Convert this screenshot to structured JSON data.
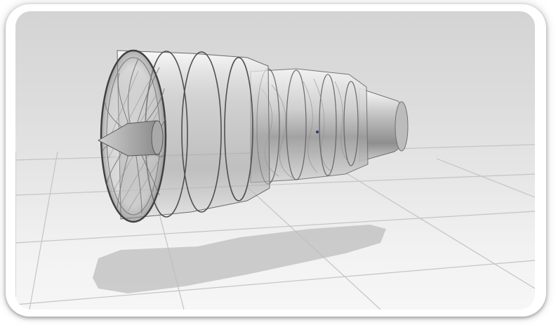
{
  "scene": {
    "background": "#d6d6d6",
    "floor_color": "#ececec",
    "grid_line_color": "#c9c9c9",
    "shadow_color": "#b8b8b8",
    "model": "turbofan-engine-model"
  }
}
